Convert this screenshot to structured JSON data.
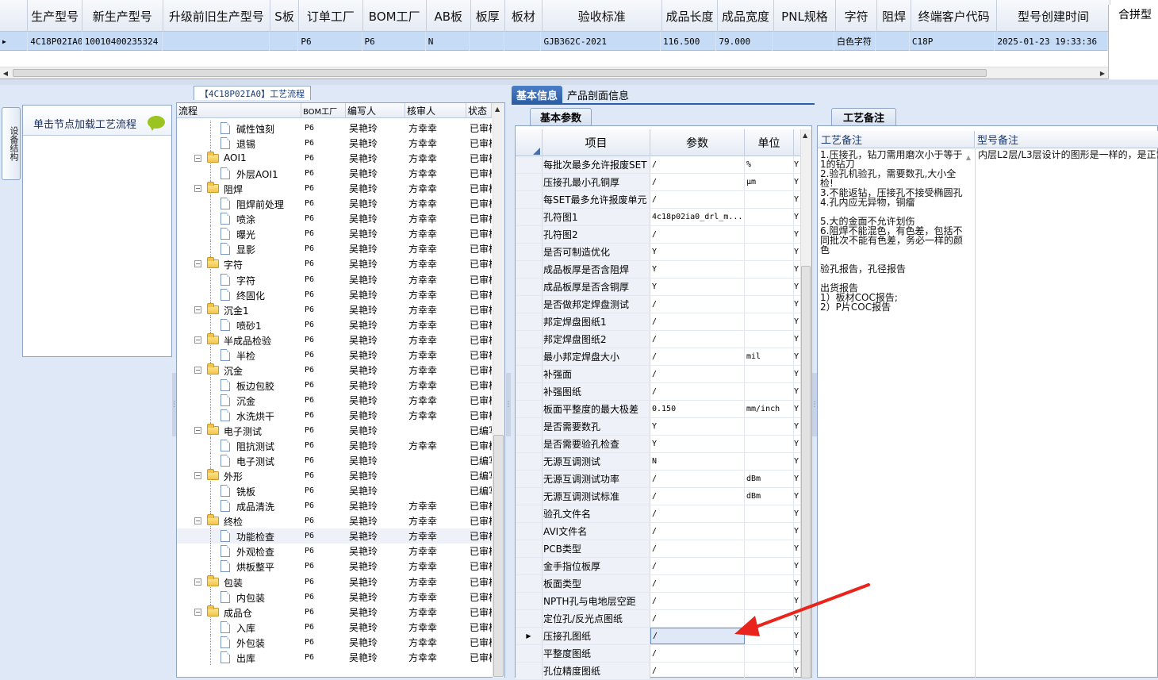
{
  "top_grid": {
    "columns": [
      "生产型号",
      "新生产型号",
      "升级前旧生产型号",
      "S板",
      "订单工厂",
      "BOM工厂",
      "AB板",
      "板厚",
      "板材",
      "验收标准",
      "成品长度",
      "成品宽度",
      "PNL规格",
      "字符",
      "阻焊",
      "终端客户代码",
      "型号创建时间"
    ],
    "row": [
      "4C18P02IA0",
      "10010400235324",
      "",
      "",
      "P6",
      "P6",
      "N",
      "",
      "",
      "GJB362C-2021",
      "116.500",
      "79.000",
      "",
      "白色字符",
      "",
      "C18P",
      "2025-01-23 19:33:36"
    ],
    "right_title": "合拼型"
  },
  "left_panel": {
    "vertical_tab": "设备结构",
    "tip": "单击节点加载工艺流程"
  },
  "tree": {
    "title": "【4C18P02IA0】工艺流程",
    "columns": [
      "流程",
      "BOM工厂",
      "编写人",
      "核审人",
      "状态"
    ],
    "rows": [
      {
        "name": "碱性蚀刻",
        "type": "leaf",
        "bom": "P6",
        "writer": "吴艳玲",
        "reviewer": "方幸幸",
        "status": "已审核"
      },
      {
        "name": "退锡",
        "type": "leaf",
        "bom": "P6",
        "writer": "吴艳玲",
        "reviewer": "方幸幸",
        "status": "已审核"
      },
      {
        "name": "AOI1",
        "type": "folder",
        "bom": "P6",
        "writer": "吴艳玲",
        "reviewer": "方幸幸",
        "status": "已审核"
      },
      {
        "name": "外层AOI1",
        "type": "leaf",
        "bom": "P6",
        "writer": "吴艳玲",
        "reviewer": "方幸幸",
        "status": "已审核"
      },
      {
        "name": "阻焊",
        "type": "folder",
        "bom": "P6",
        "writer": "吴艳玲",
        "reviewer": "方幸幸",
        "status": "已审核"
      },
      {
        "name": "阻焊前处理",
        "type": "leaf",
        "bom": "P6",
        "writer": "吴艳玲",
        "reviewer": "方幸幸",
        "status": "已审核"
      },
      {
        "name": "喷涂",
        "type": "leaf",
        "bom": "P6",
        "writer": "吴艳玲",
        "reviewer": "方幸幸",
        "status": "已审核"
      },
      {
        "name": "曝光",
        "type": "leaf",
        "bom": "P6",
        "writer": "吴艳玲",
        "reviewer": "方幸幸",
        "status": "已审核"
      },
      {
        "name": "显影",
        "type": "leaf",
        "bom": "P6",
        "writer": "吴艳玲",
        "reviewer": "方幸幸",
        "status": "已审核"
      },
      {
        "name": "字符",
        "type": "folder",
        "bom": "P6",
        "writer": "吴艳玲",
        "reviewer": "方幸幸",
        "status": "已审核"
      },
      {
        "name": "字符",
        "type": "leaf",
        "bom": "P6",
        "writer": "吴艳玲",
        "reviewer": "方幸幸",
        "status": "已审核"
      },
      {
        "name": "终固化",
        "type": "leaf",
        "bom": "P6",
        "writer": "吴艳玲",
        "reviewer": "方幸幸",
        "status": "已审核"
      },
      {
        "name": "沉金1",
        "type": "folder",
        "bom": "P6",
        "writer": "吴艳玲",
        "reviewer": "方幸幸",
        "status": "已审核"
      },
      {
        "name": "喷砂1",
        "type": "leaf",
        "bom": "P6",
        "writer": "吴艳玲",
        "reviewer": "方幸幸",
        "status": "已审核"
      },
      {
        "name": "半成品检验",
        "type": "folder",
        "bom": "P6",
        "writer": "吴艳玲",
        "reviewer": "方幸幸",
        "status": "已审核"
      },
      {
        "name": "半检",
        "type": "leaf",
        "bom": "P6",
        "writer": "吴艳玲",
        "reviewer": "方幸幸",
        "status": "已审核"
      },
      {
        "name": "沉金",
        "type": "folder",
        "bom": "P6",
        "writer": "吴艳玲",
        "reviewer": "方幸幸",
        "status": "已审核"
      },
      {
        "name": "板边包胶",
        "type": "leaf",
        "bom": "P6",
        "writer": "吴艳玲",
        "reviewer": "方幸幸",
        "status": "已审核"
      },
      {
        "name": "沉金",
        "type": "leaf",
        "bom": "P6",
        "writer": "吴艳玲",
        "reviewer": "方幸幸",
        "status": "已审核"
      },
      {
        "name": "水洗烘干",
        "type": "leaf",
        "bom": "P6",
        "writer": "吴艳玲",
        "reviewer": "方幸幸",
        "status": "已审核"
      },
      {
        "name": "电子测试",
        "type": "folder",
        "bom": "P6",
        "writer": "吴艳玲",
        "reviewer": "",
        "status": "已编写"
      },
      {
        "name": "阻抗测试",
        "type": "leaf",
        "bom": "P6",
        "writer": "吴艳玲",
        "reviewer": "方幸幸",
        "status": "已审核"
      },
      {
        "name": "电子测试",
        "type": "leaf",
        "bom": "P6",
        "writer": "吴艳玲",
        "reviewer": "",
        "status": "已编写"
      },
      {
        "name": "外形",
        "type": "folder",
        "bom": "P6",
        "writer": "吴艳玲",
        "reviewer": "",
        "status": "已编写"
      },
      {
        "name": "铣板",
        "type": "leaf",
        "bom": "P6",
        "writer": "吴艳玲",
        "reviewer": "",
        "status": "已编写"
      },
      {
        "name": "成品清洗",
        "type": "leaf",
        "bom": "P6",
        "writer": "吴艳玲",
        "reviewer": "方幸幸",
        "status": "已审核"
      },
      {
        "name": "终检",
        "type": "folder",
        "bom": "P6",
        "writer": "吴艳玲",
        "reviewer": "方幸幸",
        "status": "已审核"
      },
      {
        "name": "功能检查",
        "type": "leaf",
        "bom": "P6",
        "writer": "吴艳玲",
        "reviewer": "方幸幸",
        "status": "已审核",
        "selected": true
      },
      {
        "name": "外观检查",
        "type": "leaf",
        "bom": "P6",
        "writer": "吴艳玲",
        "reviewer": "方幸幸",
        "status": "已审核"
      },
      {
        "name": "烘板整平",
        "type": "leaf",
        "bom": "P6",
        "writer": "吴艳玲",
        "reviewer": "方幸幸",
        "status": "已审核"
      },
      {
        "name": "包装",
        "type": "folder",
        "bom": "P6",
        "writer": "吴艳玲",
        "reviewer": "方幸幸",
        "status": "已审核"
      },
      {
        "name": "内包装",
        "type": "leaf",
        "bom": "P6",
        "writer": "吴艳玲",
        "reviewer": "方幸幸",
        "status": "已审核"
      },
      {
        "name": "成品仓",
        "type": "folder",
        "bom": "P6",
        "writer": "吴艳玲",
        "reviewer": "方幸幸",
        "status": "已审核"
      },
      {
        "name": "入库",
        "type": "leaf",
        "bom": "P6",
        "writer": "吴艳玲",
        "reviewer": "方幸幸",
        "status": "已审核"
      },
      {
        "name": "外包装",
        "type": "leaf",
        "bom": "P6",
        "writer": "吴艳玲",
        "reviewer": "方幸幸",
        "status": "已审核"
      },
      {
        "name": "出库",
        "type": "leaf",
        "bom": "P6",
        "writer": "吴艳玲",
        "reviewer": "方幸幸",
        "status": "已审核"
      }
    ]
  },
  "middle": {
    "tabs": [
      "基本信息",
      "产品剖面信息"
    ],
    "sub_tab": "基本参数",
    "columns": [
      "项目",
      "参数",
      "单位"
    ],
    "rows": [
      {
        "item": "每批次最多允许报废SET",
        "param": "/",
        "unit": "%",
        "y": "Y"
      },
      {
        "item": "压接孔最小孔铜厚",
        "param": "/",
        "unit": "μm",
        "y": "Y"
      },
      {
        "item": "每SET最多允许报废单元",
        "param": "/",
        "unit": "",
        "y": "Y"
      },
      {
        "item": "孔符图1",
        "param": "4c18p02ia0_drl_m...",
        "unit": "",
        "y": "Y"
      },
      {
        "item": "孔符图2",
        "param": "/",
        "unit": "",
        "y": "Y"
      },
      {
        "item": "是否可制造优化",
        "param": "Y",
        "unit": "",
        "y": "Y"
      },
      {
        "item": "成品板厚是否含阻焊",
        "param": "Y",
        "unit": "",
        "y": "Y"
      },
      {
        "item": "成品板厚是否含铜厚",
        "param": "Y",
        "unit": "",
        "y": "Y"
      },
      {
        "item": "是否做邦定焊盘测试",
        "param": "/",
        "unit": "",
        "y": "Y"
      },
      {
        "item": "邦定焊盘图纸1",
        "param": "/",
        "unit": "",
        "y": "Y"
      },
      {
        "item": "邦定焊盘图纸2",
        "param": "/",
        "unit": "",
        "y": "Y"
      },
      {
        "item": "最小邦定焊盘大小",
        "param": "/",
        "unit": "mil",
        "y": "Y"
      },
      {
        "item": "补强面",
        "param": "/",
        "unit": "",
        "y": "Y"
      },
      {
        "item": "补强图纸",
        "param": "/",
        "unit": "",
        "y": "Y"
      },
      {
        "item": "板面平整度的最大极差",
        "param": "0.150",
        "unit": "mm/inch",
        "y": "Y"
      },
      {
        "item": "是否需要数孔",
        "param": "Y",
        "unit": "",
        "y": "Y"
      },
      {
        "item": "是否需要验孔检查",
        "param": "Y",
        "unit": "",
        "y": "Y"
      },
      {
        "item": "无源互调测试",
        "param": "N",
        "unit": "",
        "y": "Y"
      },
      {
        "item": "无源互调测试功率",
        "param": "/",
        "unit": "dBm",
        "y": "Y"
      },
      {
        "item": "无源互调测试标准",
        "param": "/",
        "unit": "dBm",
        "y": "Y"
      },
      {
        "item": "验孔文件名",
        "param": "/",
        "unit": "",
        "y": "Y"
      },
      {
        "item": "AVI文件名",
        "param": "/",
        "unit": "",
        "y": "Y"
      },
      {
        "item": "PCB类型",
        "param": "/",
        "unit": "",
        "y": "Y"
      },
      {
        "item": "金手指位板厚",
        "param": "/",
        "unit": "",
        "y": "Y"
      },
      {
        "item": "板面类型",
        "param": "/",
        "unit": "",
        "y": "Y"
      },
      {
        "item": "NPTH孔与电地层空距",
        "param": "/",
        "unit": "",
        "y": "Y"
      },
      {
        "item": "定位孔/反光点图纸",
        "param": "/",
        "unit": "",
        "y": "Y"
      },
      {
        "item": "压接孔图纸",
        "param": "/",
        "unit": "",
        "y": "Y",
        "selected": true
      },
      {
        "item": "平整度图纸",
        "param": "/",
        "unit": "",
        "y": "Y"
      },
      {
        "item": "孔位精度图纸",
        "param": "/",
        "unit": "",
        "y": "Y"
      }
    ]
  },
  "right": {
    "tab": "工艺备注",
    "col1": "工艺备注",
    "col2": "型号备注",
    "process_note": "1.压接孔，钻刀需用磨次小于等于1的钻刀\n2.验孔机验孔，需要数孔,大小全检!\n3.不能返钻，压接孔不接受椭圆孔\n4.孔内应无异物，铜瘤\n\n5.大的金面不允许划伤\n6.阻焊不能混色，有色差，包括不同批次不能有色差，务必一样的颜色\n\n验孔报告，孔径报告\n\n出货报告\n1）板材COC报告;\n2）P片COC报告",
    "model_note": "内层L2层/L3层设计的图形是一样的，是正常"
  },
  "colors": {
    "accent": "#2c5ea5",
    "selected_row": "#c6dcf6",
    "arrow": "#e8241c"
  }
}
